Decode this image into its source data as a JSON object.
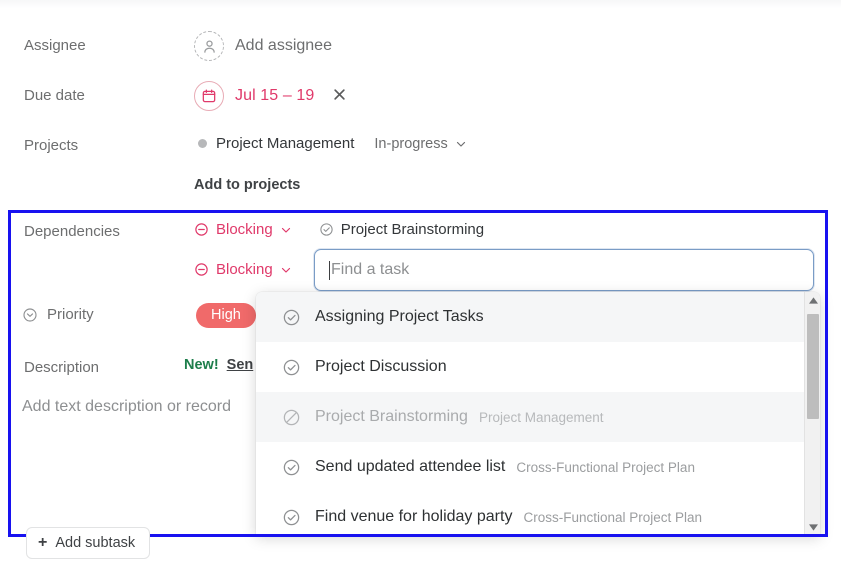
{
  "fields": {
    "assignee_label": "Assignee",
    "due_date_label": "Due date",
    "projects_label": "Projects",
    "dependencies_label": "Dependencies",
    "priority_label": "Priority",
    "description_label": "Description"
  },
  "assignee": {
    "placeholder": "Add assignee",
    "icon": "person-dashed-avatar-icon"
  },
  "due_date": {
    "value": "Jul 15 – 19",
    "icon": "calendar-icon",
    "clear_icon": "close-icon",
    "color": "#e0396a"
  },
  "projects": {
    "name": "Project Management",
    "status": "In-progress",
    "status_chevron": "chevron-down-icon",
    "dot_color": "#b7b8ba",
    "add_link": "Add to projects"
  },
  "dependencies": {
    "rows": [
      {
        "relation": "Blocking",
        "task": "Project Brainstorming"
      },
      {
        "relation": "Blocking",
        "task": ""
      }
    ],
    "relation_icon": "circle-minus-icon",
    "relation_chevron": "chevron-down-icon",
    "task_icon": "check-circle-icon",
    "relation_color": "#e0396a"
  },
  "find_task": {
    "placeholder": "Find a task",
    "value": ""
  },
  "priority": {
    "icon": "chevron-down-circle-icon",
    "value": "High",
    "pill_color": "#f06a6a"
  },
  "description": {
    "badge": "New!",
    "badge_color": "#1d7e4b",
    "link": "Sen",
    "placeholder": "Add text description or record"
  },
  "dropdown": {
    "items": [
      {
        "title": "Assigning Project Tasks",
        "project": "",
        "icon": "check-circle-icon",
        "state": "hover"
      },
      {
        "title": "Project Discussion",
        "project": "",
        "icon": "check-circle-icon",
        "state": "normal"
      },
      {
        "title": "Project Brainstorming",
        "project": "Project Management",
        "icon": "circle-slash-icon",
        "state": "disabled"
      },
      {
        "title": "Send updated attendee list",
        "project": "Cross-Functional Project Plan",
        "icon": "check-circle-icon",
        "state": "normal"
      },
      {
        "title": "Find venue for holiday party",
        "project": "Cross-Functional Project Plan",
        "icon": "check-circle-icon",
        "state": "normal"
      }
    ],
    "scrollbar": {
      "up_icon": "triangle-up-icon",
      "down_icon": "triangle-down-icon"
    }
  },
  "add_subtask": {
    "label": "Add subtask",
    "icon": "plus-icon"
  },
  "highlight": {
    "color": "#1812f0"
  }
}
